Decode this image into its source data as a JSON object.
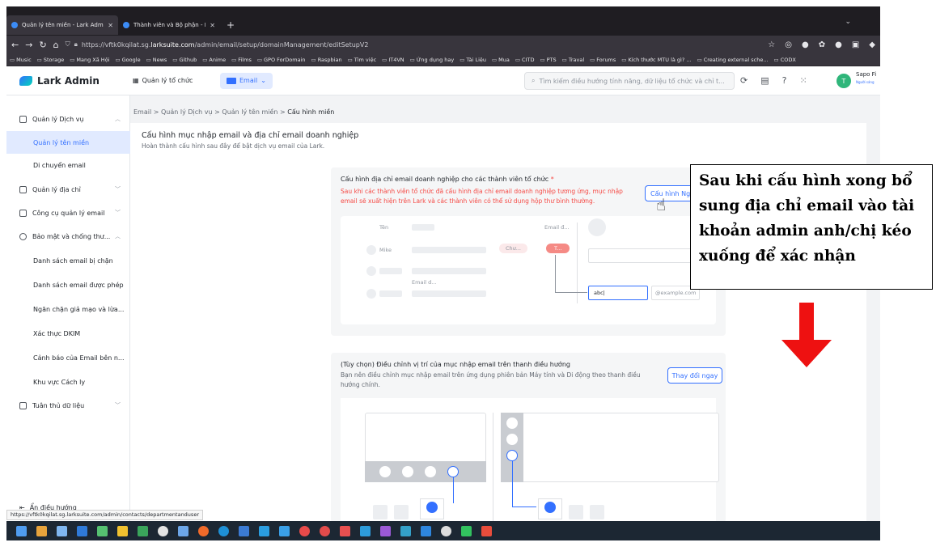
{
  "browser": {
    "tabs": [
      {
        "label": "Quản lý tên miền - Lark Admin",
        "active": true
      },
      {
        "label": "Thành viên và Bộ phận - Lark A",
        "active": false
      }
    ],
    "new_tab": "+",
    "url_prefix": "https://vftk0kqilat.sg.",
    "url_host": "larksuite.com",
    "url_path": "/admin/email/setup/domainManagement/editSetupV2",
    "bookmarks": [
      "Music",
      "Storage",
      "Mang Xã Hội",
      "Google",
      "News",
      "Github",
      "Anime",
      "Films",
      "GPO ForDomain",
      "Raspbian",
      "Tìm việc",
      "IT4VN",
      "Ứng dụng hay",
      "Tài Liệu",
      "Mua",
      "CITD",
      "PTS",
      "Traval",
      "Forums",
      "Kích thước MTU là gì? ...",
      "Creating external sche...",
      "CODX"
    ],
    "status_url": "https://vftk0kqilat.sg.larksuite.com/admin/contacts/departmentanduser"
  },
  "header": {
    "brand": "Lark Admin",
    "org_link": "Quản lý tổ chức",
    "email_tab": "Email",
    "search_placeholder": "Tìm kiếm điều hướng tính năng, dữ liệu tổ chức và chỉ t...",
    "avatar_letter": "T",
    "user_name": "Sapo Fi",
    "user_sub": "Người sáng"
  },
  "sidebar": {
    "groups": [
      {
        "label": "Quản lý Dịch vụ"
      },
      {
        "label": "Quản lý địa chỉ"
      },
      {
        "label": "Công cụ quản lý email"
      },
      {
        "label": "Bảo mật và chống thư..."
      },
      {
        "label": "Tuân thủ dữ liệu"
      }
    ],
    "items": [
      {
        "label": "Quản lý tên miền",
        "active": true
      },
      {
        "label": "Di chuyển email"
      },
      {
        "label": "Danh sách email bị chặn"
      },
      {
        "label": "Danh sách email được phép"
      },
      {
        "label": "Ngăn chặn giả mạo và lừa..."
      },
      {
        "label": "Xác thực DKIM"
      },
      {
        "label": "Cảnh báo của Email bên n..."
      },
      {
        "label": "Khu vực Cách ly"
      }
    ],
    "hide_nav": "Ẩn điều hướng"
  },
  "breadcrumb": {
    "items": [
      "Email",
      "Quản lý Dịch vụ",
      "Quản lý tên miền"
    ],
    "separator": ">",
    "current": "Cấu hình miền"
  },
  "main": {
    "title": "Cấu hình mục nhập email và địa chỉ email doanh nghiệp",
    "subtitle": "Hoàn thành cấu hình sau đây để bật dịch vụ email của Lark.",
    "step1": {
      "title": "Cấu hình địa chỉ email doanh nghiệp cho các thành viên tổ chức",
      "required_mark": "*",
      "warning": "Sau khi các thành viên tổ chức đã cấu hình địa chỉ email doanh nghiệp tương ứng, mục nhập email sẽ xuất hiện trên Lark và các thành viên có thể sử dụng hộp thư bình thường.",
      "button": "Cấu hình Ngay",
      "illus": {
        "col_name": "Tên",
        "col_email": "Email đ...",
        "row_name": "Mike",
        "tag_pending": "Chư...",
        "tag_t": "T...",
        "email_label": "Email d...",
        "input_value": "abc|",
        "domain": "@example.com"
      }
    },
    "step2": {
      "title": "(Tùy chọn) Điều chỉnh vị trí của mục nhập email trên thanh điều hướng",
      "desc": "Bạn nên điều chỉnh mục nhập email trên ứng dụng phiên bản Máy tính và Di động theo thanh điều hướng chính.",
      "button": "Thay đổi ngay"
    }
  },
  "annotation": {
    "text": "Sau khi cấu hình xong bổ sung địa chỉ email vào tài khoản admin anh/chị kéo xuống để xác nhận",
    "arrow_color": "#ee1111"
  },
  "colors": {
    "accent": "#3370ff",
    "danger": "#f54a45",
    "sidebar_active_bg": "#e1eaff"
  }
}
